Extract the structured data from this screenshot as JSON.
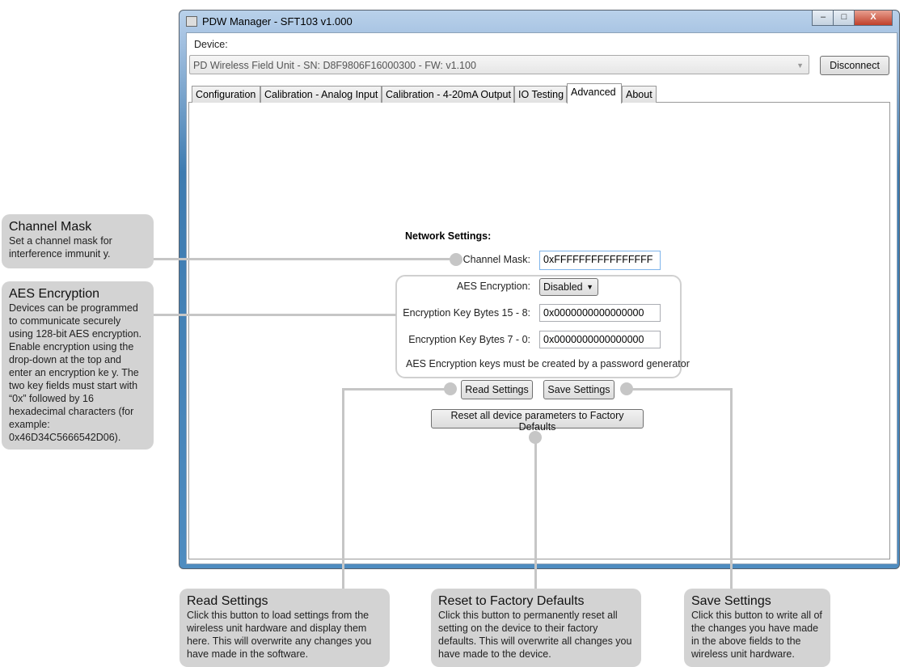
{
  "window": {
    "title": "PDW Manager - SFT103 v1.000",
    "minimize": "–",
    "maximize": "□",
    "close": "X"
  },
  "device": {
    "label": "Device:",
    "selected": "PD Wireless Field Unit - SN: D8F9806F16000300 - FW: v1.100",
    "disconnect": "Disconnect"
  },
  "tabs": [
    {
      "label": "Configuration"
    },
    {
      "label": "Calibration - Analog Input"
    },
    {
      "label": "Calibration - 4-20mA Output"
    },
    {
      "label": "IO Testing"
    },
    {
      "label": "Advanced",
      "active": true
    },
    {
      "label": "About"
    }
  ],
  "network": {
    "heading": "Network Settings:",
    "channel_mask_label": "Channel Mask:",
    "channel_mask_value": "0xFFFFFFFFFFFFFFFF",
    "aes_label": "AES Encryption:",
    "aes_value": "Disabled",
    "key_hi_label": "Encryption Key Bytes 15 - 8:",
    "key_hi_value": "0x0000000000000000",
    "key_lo_label": "Encryption Key Bytes 7 - 0:",
    "key_lo_value": "0x0000000000000000",
    "note": "AES Encryption keys must be created by a password generator",
    "read": "Read Settings",
    "save": "Save Settings",
    "reset": "Reset all device parameters to Factory Defaults"
  },
  "callouts": {
    "channel": {
      "title": "Channel Mask",
      "body": "Set a channel mask for interference immunit y."
    },
    "aes": {
      "title": "AES Encryption",
      "body": "Devices can be programmed to communicate securely using 128-bit AES encryption. Enable encryption using the drop-down at the top and enter an encryption ke y. The two key fields must start with “0x” followed by 16 hexadecimal characters (for example: 0x46D34C5666542D06)."
    },
    "read": {
      "title": "Read Settings",
      "body": "Click this button to load settings from the wireless unit hardware and display them here.  This will overwrite any changes you have made in the software."
    },
    "reset": {
      "title": "Reset to Factory Defaults",
      "body": "Click this button to permanently reset all setting on the device to their factory defaults. This will overwrite all changes you have made to the device."
    },
    "save": {
      "title": "Save Settings",
      "body": "Click this button to write all of the changes you have made in the above fields to the wireless unit hardware."
    }
  }
}
